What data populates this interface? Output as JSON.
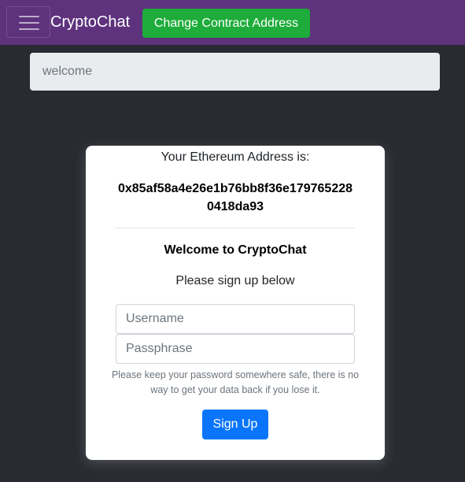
{
  "navbar": {
    "brand": "CryptoChat",
    "change_contract_label": "Change Contract Address",
    "menu_icon": "hamburger-icon",
    "background": "#5e327d"
  },
  "status": {
    "text": "welcome"
  },
  "card": {
    "address_label": "Your Ethereum Address is:",
    "address_value": "0x85af58a4e26e1b76bb8f36e1797652280418da93",
    "welcome_title": "Welcome to CryptoChat",
    "signup_prompt": "Please sign up below",
    "username_placeholder": "Username",
    "username_value": "",
    "passphrase_placeholder": "Passphrase",
    "passphrase_value": "",
    "hint": "Please keep your password somewhere safe, there is no way to get your data back if you lose it.",
    "signup_label": "Sign Up"
  },
  "colors": {
    "page_background": "#282b31",
    "contract_button": "#1eac3a",
    "signup_button": "#0a75fb"
  }
}
